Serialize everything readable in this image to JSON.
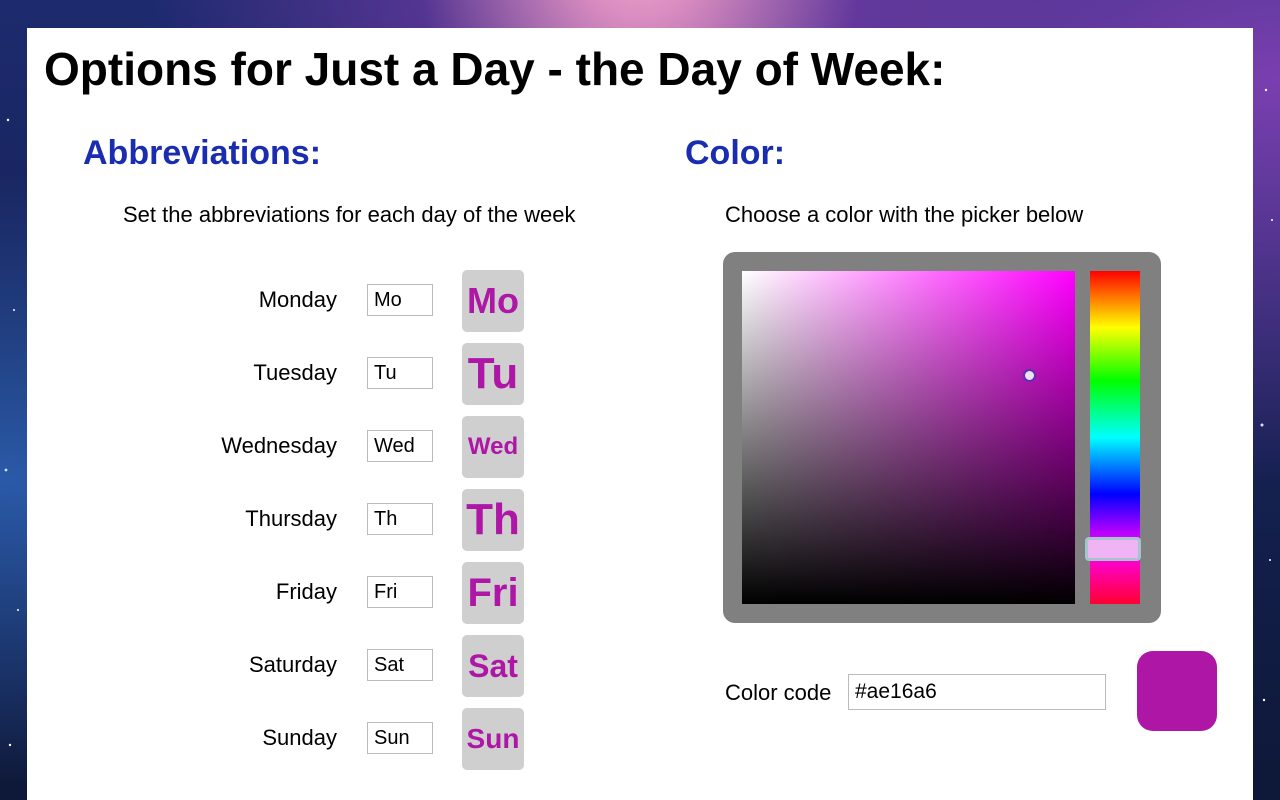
{
  "page_title": "Options for Just a Day - the Day of Week:",
  "abbreviations": {
    "title": "Abbreviations:",
    "description": "Set the abbreviations for each day of the week",
    "days": [
      {
        "day": "Monday",
        "abbr": "Mo",
        "preview": "Mo"
      },
      {
        "day": "Tuesday",
        "abbr": "Tu",
        "preview": "Tu"
      },
      {
        "day": "Wednesday",
        "abbr": "Wed",
        "preview": "Wed"
      },
      {
        "day": "Thursday",
        "abbr": "Th",
        "preview": "Th"
      },
      {
        "day": "Friday",
        "abbr": "Fri",
        "preview": "Fri"
      },
      {
        "day": "Saturday",
        "abbr": "Sat",
        "preview": "Sat"
      },
      {
        "day": "Sunday",
        "abbr": "Sun",
        "preview": "Sun"
      }
    ]
  },
  "color": {
    "title": "Color:",
    "description": "Choose a color with the picker below",
    "code_label": "Color code",
    "code_value": "#ae16a6",
    "swatch_color": "#ae16a6",
    "hue_color": "#ff00ff"
  }
}
